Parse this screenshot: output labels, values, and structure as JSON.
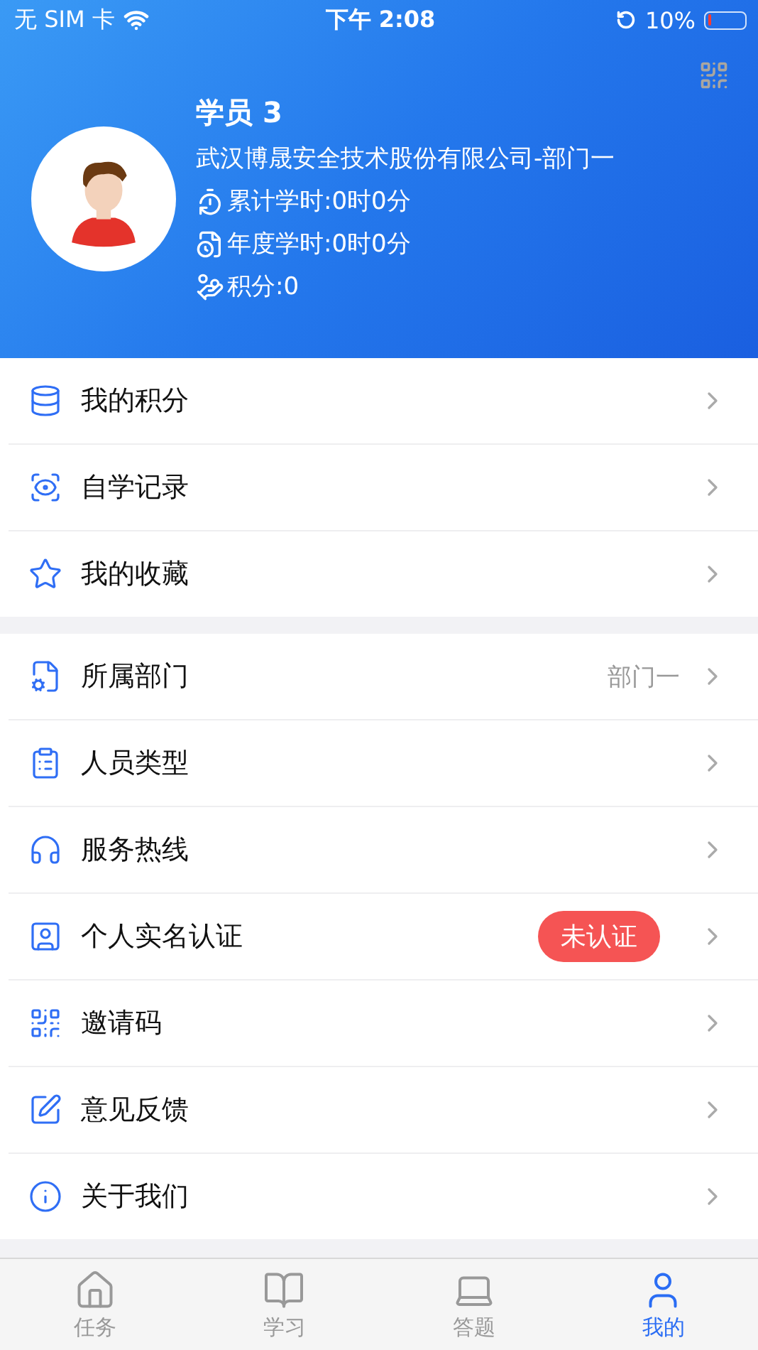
{
  "status_bar": {
    "carrier": "无 SIM 卡",
    "time": "下午 2:08",
    "battery": "10%"
  },
  "profile": {
    "name": "学员 3",
    "organization": "武汉博晟安全技术股份有限公司-部门一",
    "stats": [
      {
        "kind": "total",
        "text": "累计学时:0时0分"
      },
      {
        "kind": "annual",
        "text": "年度学时:0时0分"
      },
      {
        "kind": "points",
        "text": "积分:0"
      }
    ]
  },
  "menu_groups": [
    {
      "items": [
        {
          "kind": "points",
          "label": "我的积分"
        },
        {
          "kind": "records",
          "label": "自学记录"
        },
        {
          "kind": "favorites",
          "label": "我的收藏"
        }
      ]
    },
    {
      "items": [
        {
          "kind": "department",
          "label": "所属部门",
          "value": "部门一"
        },
        {
          "kind": "type",
          "label": "人员类型"
        },
        {
          "kind": "hotline",
          "label": "服务热线"
        },
        {
          "kind": "verify",
          "label": "个人实名认证",
          "badge": "未认证"
        },
        {
          "kind": "invite",
          "label": "邀请码"
        },
        {
          "kind": "feedback",
          "label": "意见反馈"
        },
        {
          "kind": "about",
          "label": "关于我们"
        }
      ]
    }
  ],
  "tabs": [
    {
      "kind": "tasks",
      "label": "任务",
      "selected": false
    },
    {
      "kind": "study",
      "label": "学习",
      "selected": false
    },
    {
      "kind": "answer",
      "label": "答题",
      "selected": false
    },
    {
      "kind": "me",
      "label": "我的",
      "selected": true
    }
  ]
}
